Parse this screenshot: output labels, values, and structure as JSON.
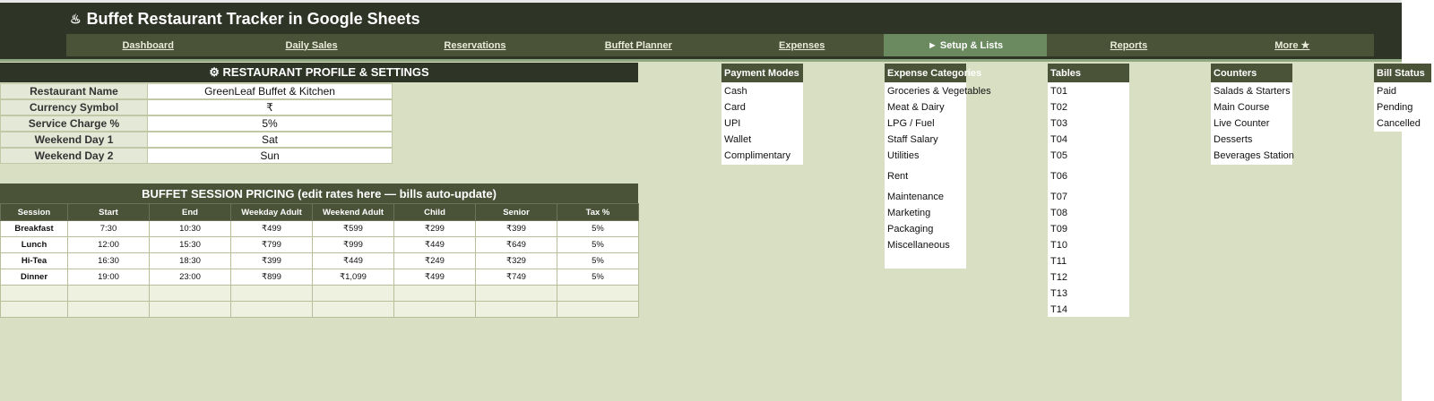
{
  "app": {
    "title": "Buffet Restaurant Tracker in Google Sheets",
    "title_icon": "flame-icon"
  },
  "nav": {
    "tabs": [
      {
        "label": "Dashboard",
        "active": false
      },
      {
        "label": "Daily Sales",
        "active": false
      },
      {
        "label": "Reservations",
        "active": false
      },
      {
        "label": "Buffet Planner",
        "active": false
      },
      {
        "label": "Expenses",
        "active": false
      },
      {
        "label": "► Setup & Lists",
        "active": true
      },
      {
        "label": "Reports",
        "active": false
      },
      {
        "label": "More ★",
        "active": false
      }
    ]
  },
  "profile": {
    "heading": "⚙ RESTAURANT PROFILE & SETTINGS",
    "rows": [
      {
        "key": "Restaurant Name",
        "value": "GreenLeaf Buffet & Kitchen"
      },
      {
        "key": "Currency Symbol",
        "value": "₹"
      },
      {
        "key": "Service Charge %",
        "value": "5%"
      },
      {
        "key": "Weekend Day 1",
        "value": "Sat"
      },
      {
        "key": "Weekend Day 2",
        "value": "Sun"
      }
    ]
  },
  "pricing": {
    "heading": "BUFFET SESSION PRICING (edit rates here — bills auto-update)",
    "columns": [
      "Session",
      "Start",
      "End",
      "Weekday Adult",
      "Weekend Adult",
      "Child",
      "Senior",
      "Tax %"
    ],
    "rows": [
      [
        "Breakfast",
        "7:30",
        "10:30",
        "₹499",
        "₹599",
        "₹299",
        "₹399",
        "5%"
      ],
      [
        "Lunch",
        "12:00",
        "15:30",
        "₹799",
        "₹999",
        "₹449",
        "₹649",
        "5%"
      ],
      [
        "Hi-Tea",
        "16:30",
        "18:30",
        "₹399",
        "₹449",
        "₹249",
        "₹329",
        "5%"
      ],
      [
        "Dinner",
        "19:00",
        "23:00",
        "₹899",
        "₹1,099",
        "₹499",
        "₹749",
        "5%"
      ]
    ]
  },
  "lists": {
    "payment_modes": {
      "header": "Payment Modes",
      "items": [
        "Cash",
        "Card",
        "UPI",
        "Wallet",
        "Complimentary"
      ]
    },
    "expense_categories": {
      "header": "Expense Categories",
      "items": [
        "Groceries & Vegetables",
        "Meat & Dairy",
        "LPG / Fuel",
        "Staff Salary",
        "Utilities",
        "Rent",
        "Maintenance",
        "Marketing",
        "Packaging",
        "Miscellaneous"
      ]
    },
    "tables": {
      "header": "Tables",
      "items": [
        "T01",
        "T02",
        "T03",
        "T04",
        "T05",
        "T06",
        "T07",
        "T08",
        "T09",
        "T10",
        "T11",
        "T12",
        "T13",
        "T14"
      ]
    },
    "counters": {
      "header": "Counters",
      "items": [
        "Salads & Starters",
        "Main Course",
        "Live Counter",
        "Desserts",
        "Beverages Station"
      ]
    },
    "bill_status": {
      "header": "Bill Status",
      "items": [
        "Paid",
        "Pending",
        "Cancelled"
      ]
    }
  }
}
